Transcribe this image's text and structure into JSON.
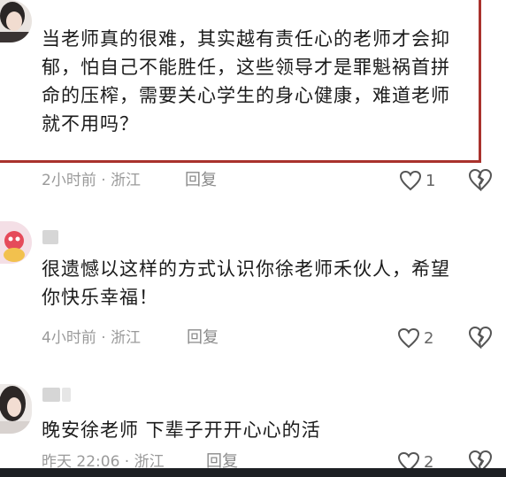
{
  "comments": [
    {
      "text_lines": [
        "当老师真的很难，其实越有责任心的老师才会抑",
        "郁，怕自己不能胜任，这些领导才是罪魁祸首拼",
        "命的压榨，需要关心学生的身心健康，难道老师",
        "就不用吗？"
      ],
      "meta": "2小时前 · 浙江",
      "reply_label": "回复",
      "likes": "1"
    },
    {
      "text_lines": [
        "很遗憾以这样的方式认识你徐老师禾伙人，希望",
        "你快乐幸福！"
      ],
      "meta": "4小时前 · 浙江",
      "reply_label": "回复",
      "likes": "2"
    },
    {
      "text_lines": [
        "晚安徐老师 下辈子开开心心的活"
      ],
      "meta": "昨天 22:06 · 浙江",
      "reply_label": "回复",
      "likes": "2"
    }
  ],
  "colors": {
    "highlight_border": "#a9322d",
    "meta_text": "#9a9a9a",
    "body_text": "#1b1b1b"
  },
  "icons": {
    "like": "heart-outline-icon",
    "dislike": "broken-heart-icon"
  }
}
